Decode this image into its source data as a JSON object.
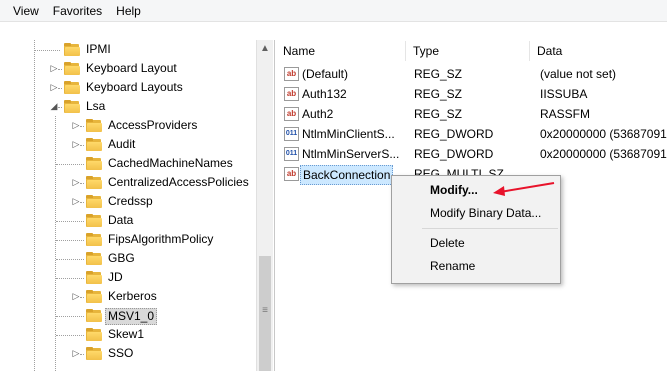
{
  "menu": [
    "View",
    "Favorites",
    "Help"
  ],
  "tree": {
    "items": [
      {
        "label": "IPMI",
        "expander": ""
      },
      {
        "label": "Keyboard Layout",
        "expander": "▷"
      },
      {
        "label": "Keyboard Layouts",
        "expander": "▷"
      },
      {
        "label": "Lsa",
        "expander": "◢"
      },
      {
        "label": "AccessProviders",
        "expander": "▷"
      },
      {
        "label": "Audit",
        "expander": "▷"
      },
      {
        "label": "CachedMachineNames",
        "expander": ""
      },
      {
        "label": "CentralizedAccessPolicies",
        "expander": "▷"
      },
      {
        "label": "Credssp",
        "expander": "▷"
      },
      {
        "label": "Data",
        "expander": ""
      },
      {
        "label": "FipsAlgorithmPolicy",
        "expander": ""
      },
      {
        "label": "GBG",
        "expander": ""
      },
      {
        "label": "JD",
        "expander": ""
      },
      {
        "label": "Kerberos",
        "expander": "▷"
      },
      {
        "label": "MSV1_0",
        "expander": ""
      },
      {
        "label": "Skew1",
        "expander": ""
      },
      {
        "label": "SSO",
        "expander": "▷"
      }
    ],
    "selected_index": 14
  },
  "list": {
    "columns": [
      "Name",
      "Type",
      "Data"
    ],
    "rows": [
      {
        "icon": "ab",
        "name": "(Default)",
        "type": "REG_SZ",
        "data": "(value not set)"
      },
      {
        "icon": "ab",
        "name": "Auth132",
        "type": "REG_SZ",
        "data": "IISSUBA"
      },
      {
        "icon": "ab",
        "name": "Auth2",
        "type": "REG_SZ",
        "data": "RASSFM"
      },
      {
        "icon": "011",
        "name": "NtlmMinClientS...",
        "type": "REG_DWORD",
        "data": "0x20000000 (53687091"
      },
      {
        "icon": "011",
        "name": "NtlmMinServerS...",
        "type": "REG_DWORD",
        "data": "0x20000000 (53687091"
      },
      {
        "icon": "ab",
        "name": "BackConnection",
        "type": "REG_MULTI_SZ",
        "data": ""
      }
    ],
    "selected_index": 5
  },
  "context_menu": {
    "items": [
      "Modify...",
      "Modify Binary Data...",
      "Delete",
      "Rename"
    ]
  },
  "colors": {
    "selection": "#cce8ff",
    "folder": "#f2c14a",
    "annotation_arrow": "#e8132b"
  }
}
